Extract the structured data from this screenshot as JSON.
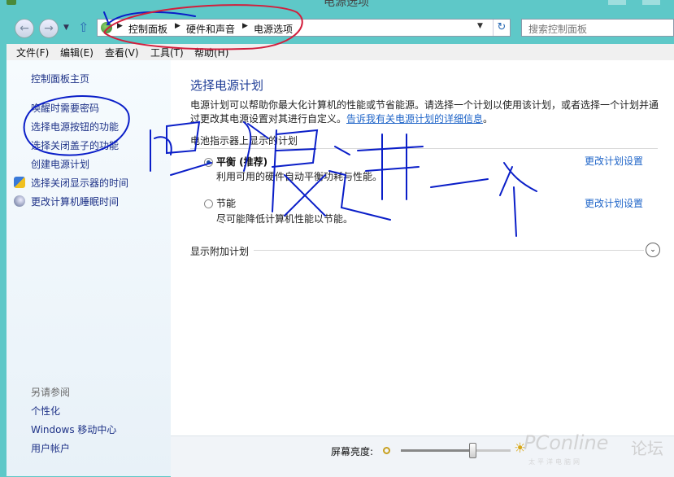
{
  "window": {
    "title": "电源选项"
  },
  "nav": {
    "back_icon": "back-arrow-icon",
    "forward_icon": "forward-arrow-icon",
    "up_icon": "up-arrow-icon"
  },
  "address": {
    "crumbs": [
      "控制面板",
      "硬件和声音",
      "电源选项"
    ],
    "search_placeholder": "搜索控制面板"
  },
  "menu": {
    "items": [
      "文件(F)",
      "编辑(E)",
      "查看(V)",
      "工具(T)",
      "帮助(H)"
    ]
  },
  "sidebar": {
    "home": "控制面板主页",
    "links": [
      "唤醒时需要密码",
      "选择电源按钮的功能",
      "选择关闭盖子的功能",
      "创建电源计划",
      "选择关闭显示器的时间",
      "更改计算机睡眠时间"
    ],
    "see_also_title": "另请参阅",
    "see_also": [
      "个性化",
      "Windows 移动中心",
      "用户帐户"
    ]
  },
  "main": {
    "title": "选择电源计划",
    "description": "电源计划可以帮助你最大化计算机的性能或节省能源。请选择一个计划以使用该计划，或者选择一个计划并通过更改其电源设置对其进行自定义。",
    "description_link": "告诉我有关电源计划的详细信息",
    "description_end": "。",
    "battery_group_label": "电池指示器上显示的计划",
    "plans": [
      {
        "name": "平衡 (推荐)",
        "desc": "利用可用的硬件自动平衡功耗与性能。",
        "link": "更改计划设置",
        "selected": true
      },
      {
        "name": "节能",
        "desc": "尽可能降低计算机性能以节能。",
        "link": "更改计划设置",
        "selected": false
      }
    ],
    "extra_plans_label": "显示附加计划"
  },
  "status": {
    "brightness_label": "屏幕亮度:",
    "brightness_value": 0.65
  },
  "watermark": {
    "brand": "PConline",
    "sub": "太平洋电脑网",
    "forum": "论坛"
  },
  "colors": {
    "accent": "#1e3c96",
    "link": "#1e64c8",
    "annotation_ink": "#0a1ec8",
    "annotation_red": "#d21e3c"
  }
}
